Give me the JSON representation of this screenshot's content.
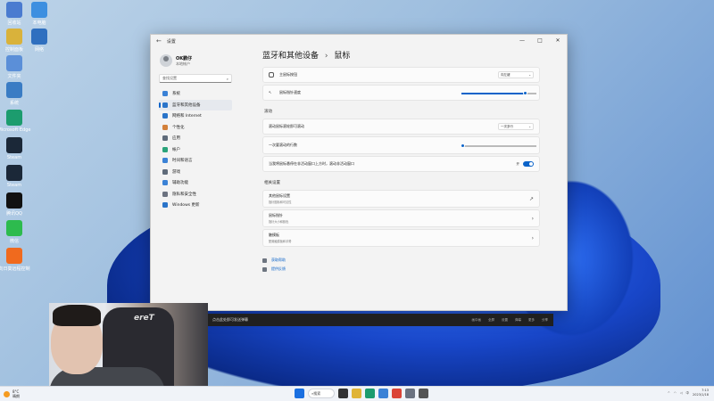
{
  "desktop": {
    "icons": [
      {
        "label": "回收站",
        "icon": "recycle-bin-icon",
        "color": "#4a7bd0"
      },
      {
        "label": "本电脑",
        "icon": "computer-icon",
        "color": "#3d8fe0"
      },
      {
        "label": "控制面板",
        "icon": "folder-icon",
        "color": "#d9b23b"
      },
      {
        "label": "网络",
        "icon": "network-icon",
        "color": "#2f6fbf"
      },
      {
        "label": "文件夹",
        "icon": "folder-icon",
        "color": "#5b8fd8"
      },
      {
        "label": "系统",
        "icon": "system-icon",
        "color": "#3a7cc4"
      },
      {
        "label": "Microsoft Edge",
        "icon": "edge-icon",
        "color": "#1c9c6e"
      },
      {
        "label": "Steam",
        "icon": "steam-icon",
        "color": "#1b2838"
      },
      {
        "label": "Steam",
        "icon": "steam-icon",
        "color": "#1b2838"
      },
      {
        "label": "腾讯QQ",
        "icon": "qq-icon",
        "color": "#111111"
      },
      {
        "label": "微信",
        "icon": "wechat-icon",
        "color": "#2dbb4e"
      },
      {
        "label": "向日葵远程控制",
        "icon": "sunflower-icon",
        "color": "#f06a1e"
      }
    ]
  },
  "window": {
    "title": "设置",
    "controls": [
      "—",
      "□",
      "✕"
    ]
  },
  "sidebar": {
    "user_name": "OK鹏仔",
    "user_sub": "本地帐户",
    "search_placeholder": "查找设置",
    "items": [
      {
        "label": "系统",
        "color": "#3b82d6",
        "active": false
      },
      {
        "label": "蓝牙和其他设备",
        "color": "#2a74c9",
        "active": true
      },
      {
        "label": "网络和 Internet",
        "color": "#2a74c9",
        "active": false
      },
      {
        "label": "个性化",
        "color": "#d3803a",
        "active": false
      },
      {
        "label": "应用",
        "color": "#5f6b7a",
        "active": false
      },
      {
        "label": "帐户",
        "color": "#2aa37a",
        "active": false
      },
      {
        "label": "时间和语言",
        "color": "#3b82d6",
        "active": false
      },
      {
        "label": "游戏",
        "color": "#5f6b7a",
        "active": false
      },
      {
        "label": "辅助功能",
        "color": "#3b82d6",
        "active": false
      },
      {
        "label": "隐私和安全性",
        "color": "#6b7280",
        "active": false
      },
      {
        "label": "Windows 更新",
        "color": "#2a74c9",
        "active": false
      }
    ]
  },
  "main": {
    "breadcrumb_parent": "蓝牙和其他设备",
    "breadcrumb_sep": "›",
    "breadcrumb_current": "鼠标",
    "primary_button_label": "主鼠标按钮",
    "primary_button_value": "向左键",
    "pointer_speed_label": "鼠标指针速度",
    "pointer_speed_value": 0.85,
    "scroll_section": "滚动",
    "scroll_mode_label": "滚动鼠标滚轮即可滚动",
    "scroll_mode_value": "一次多行",
    "lines_label": "一次要滚动的行数",
    "lines_value": 0.02,
    "inactive_scroll_label": "当我将鼠标悬停在非活动窗口上方时，滚动非活动窗口",
    "inactive_scroll_state": "开",
    "related_section": "相关设置",
    "related": [
      {
        "title": "其他鼠标设置",
        "sub": "指针图标和可见性",
        "chevron": "↗"
      },
      {
        "title": "鼠标指针",
        "sub": "指针大小和颜色",
        "chevron": "›"
      },
      {
        "title": "触摸板",
        "sub": "配置触摸板和手势",
        "chevron": "›"
      }
    ],
    "help_link": "获取帮助",
    "feedback_link": "提供反馈"
  },
  "darkbar": {
    "text": "点击此处即可发送弹幕",
    "right_items": [
      "画中画",
      "全屏",
      "设置",
      "弹幕",
      "更多",
      "分享"
    ]
  },
  "webcam": {
    "brand_text": "ereT"
  },
  "taskbar": {
    "weather_temp": "8°C",
    "weather_desc": "晴朗",
    "search_label": "搜索",
    "apps": [
      {
        "icon": "start-icon",
        "color": "#1a6fe0"
      },
      {
        "icon": "taskview-icon",
        "color": "#333333"
      },
      {
        "icon": "explorer-icon",
        "color": "#e0b437"
      },
      {
        "icon": "edge-icon",
        "color": "#1c9c6e"
      },
      {
        "icon": "store-icon",
        "color": "#3b82d6"
      },
      {
        "icon": "chrome-icon",
        "color": "#db4437"
      },
      {
        "icon": "app-icon",
        "color": "#6b7280"
      },
      {
        "icon": "settings-icon",
        "color": "#555555"
      }
    ],
    "lang": "中",
    "time": "7:13",
    "date": "2023/1/18"
  }
}
